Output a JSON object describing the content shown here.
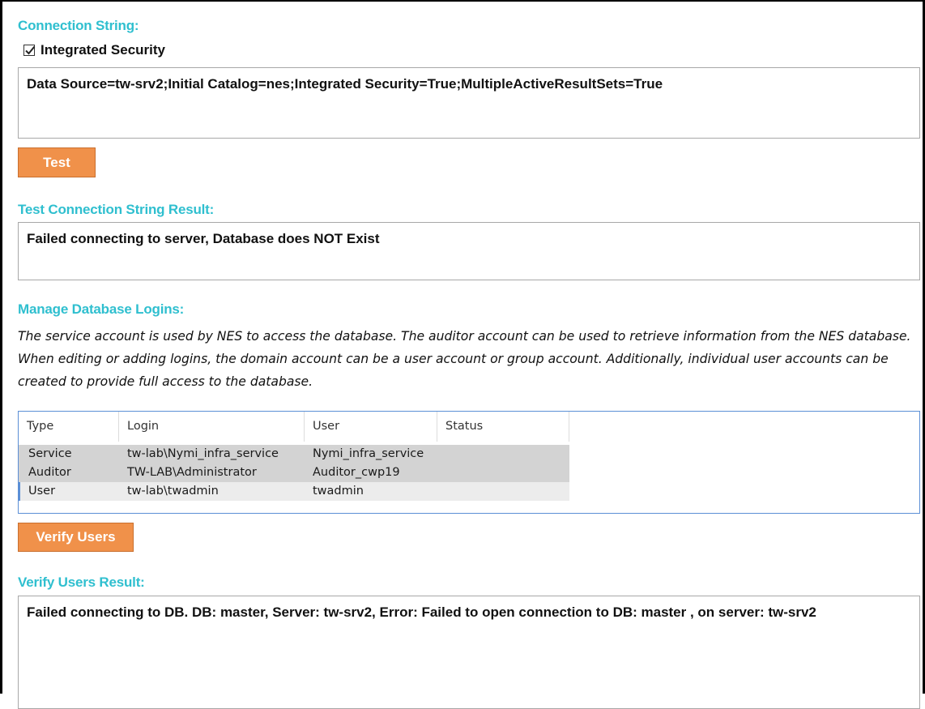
{
  "connection": {
    "label": "Connection String:",
    "integrated_security_label": "Integrated Security",
    "integrated_security_checked": true,
    "value": "Data Source=tw-srv2;Initial Catalog=nes;Integrated Security=True;MultipleActiveResultSets=True",
    "test_button": "Test"
  },
  "test_result": {
    "label": "Test Connection String Result:",
    "value": "Failed connecting to server, Database does NOT Exist"
  },
  "logins": {
    "label": "Manage Database Logins:",
    "description": "The service account is used by NES to access the database. The auditor account can be used to retrieve information from the NES database. When editing or adding logins, the domain account can be a user account or group account. Additionally, individual user accounts can be created to provide full access to the database.",
    "columns": [
      "Type",
      "Login",
      "User",
      "Status"
    ],
    "rows": [
      {
        "type": "Service",
        "login": "tw-lab\\Nymi_infra_service",
        "user": "Nymi_infra_service",
        "status": ""
      },
      {
        "type": "Auditor",
        "login": "TW-LAB\\Administrator",
        "user": "Auditor_cwp19",
        "status": ""
      },
      {
        "type": "User",
        "login": "tw-lab\\twadmin",
        "user": "twadmin",
        "status": ""
      }
    ],
    "verify_button": "Verify Users"
  },
  "verify_result": {
    "label": "Verify Users Result:",
    "value": "Failed connecting to DB. DB: master, Server: tw-srv2, Error: Failed to open connection to DB: master , on server: tw-srv2"
  },
  "colors": {
    "label_teal": "#2fbfcf",
    "button_orange": "#f0914a",
    "grid_border": "#5b8fd6"
  }
}
